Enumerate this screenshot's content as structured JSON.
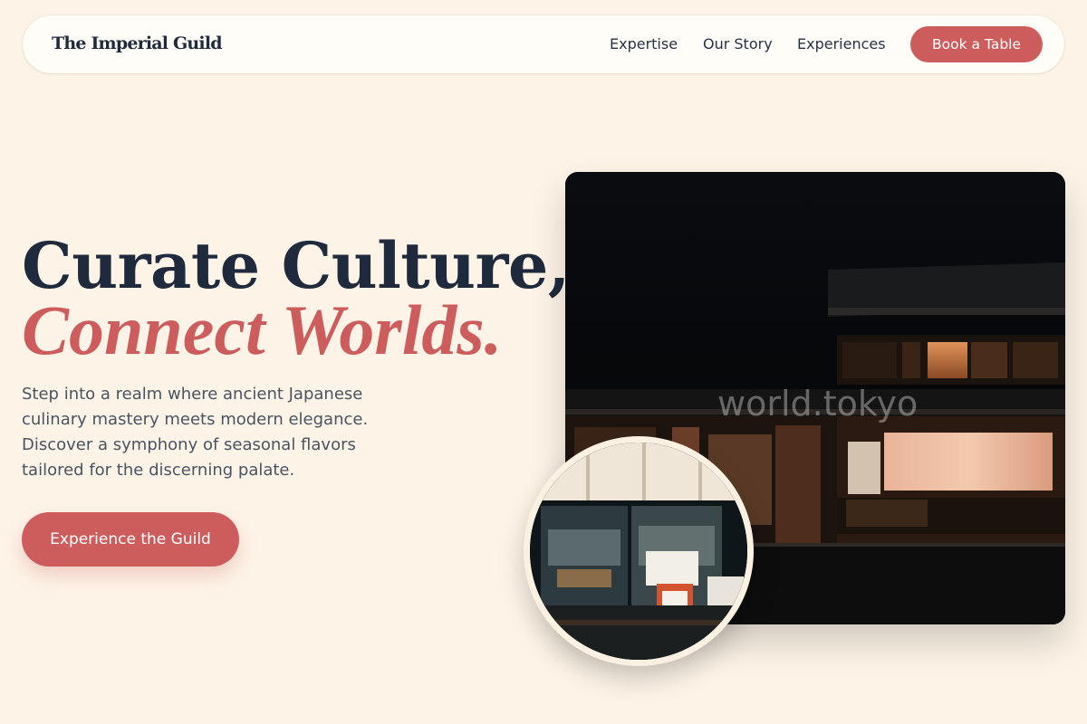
{
  "nav": {
    "brand": "The Imperial Guild",
    "links": [
      "Expertise",
      "Our Story",
      "Experiences"
    ],
    "book_label": "Book a Table"
  },
  "hero": {
    "line1": "Curate Culture,",
    "line2": "Connect Worlds.",
    "lead": "Step into a realm where ancient Japanese culinary mastery meets modern elegance. Discover a symphony of seasonal flavors tailored for the discerning palate.",
    "cta_label": "Experience the Guild"
  },
  "image": {
    "watermark": "world.tokyo"
  },
  "colors": {
    "background": "#fdf4e7",
    "accent": "#cd5d5d",
    "ink": "#1f2a3c"
  }
}
